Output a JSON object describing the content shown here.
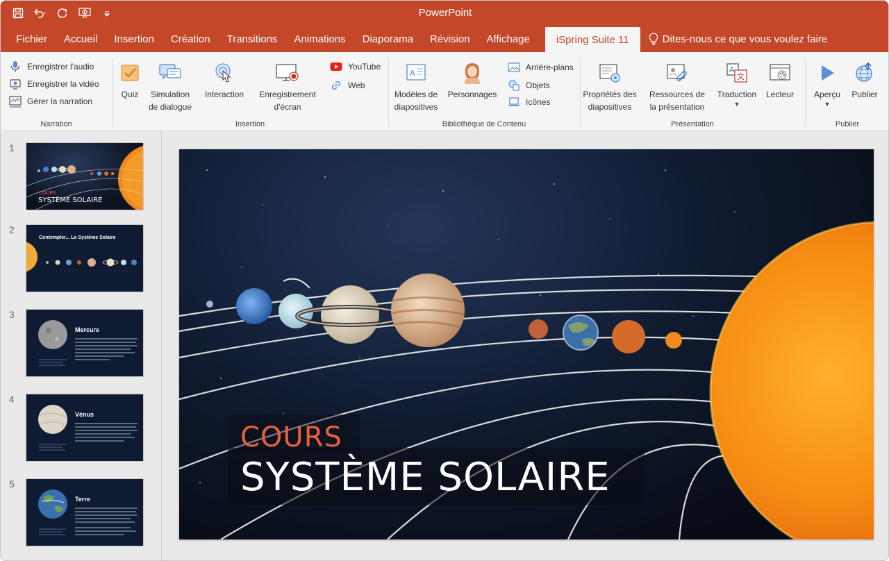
{
  "app": {
    "title": "PowerPoint"
  },
  "qat": {
    "items": [
      "save-icon",
      "undo-icon",
      "redo-icon",
      "present-icon",
      "customize-icon"
    ]
  },
  "tabs": [
    {
      "label": "Fichier"
    },
    {
      "label": "Accueil"
    },
    {
      "label": "Insertion"
    },
    {
      "label": "Création"
    },
    {
      "label": "Transitions"
    },
    {
      "label": "Animations"
    },
    {
      "label": "Diaporama"
    },
    {
      "label": "Révision"
    },
    {
      "label": "Affichage"
    },
    {
      "label": "iSpring Suite 11"
    }
  ],
  "tell_me": {
    "label": "Dites-nous ce que vous voulez faire"
  },
  "ribbon": {
    "narration": {
      "label": "Narration",
      "record_audio": "Enregistrer l'audio",
      "record_video": "Enregistrer la vidéo",
      "manage_narration": "Gérer la narration"
    },
    "insertion": {
      "label": "Insertion",
      "quiz": "Quiz",
      "dialog_sim_line1": "Simulation",
      "dialog_sim_line2": "de dialogue",
      "interaction": "Interaction",
      "screen_rec_line1": "Enregistrement",
      "screen_rec_line2": "d'écran",
      "youtube": "YouTube",
      "web": "Web"
    },
    "content_library": {
      "label": "Bibliothèque de Contenu",
      "templates_line1": "Modèles de",
      "templates_line2": "diapositives",
      "characters": "Personnages",
      "backgrounds": "Arrière-plans",
      "objects": "Objets",
      "icons": "Icônes"
    },
    "presentation": {
      "label": "Présentation",
      "slide_props_line1": "Propriétés des",
      "slide_props_line2": "diapositives",
      "resources_line1": "Ressources de",
      "resources_line2": "la présentation",
      "translation": "Traduction",
      "player": "Lecteur"
    },
    "publish": {
      "label": "Publier",
      "preview": "Aperçu",
      "publish": "Publier"
    }
  },
  "slides": [
    {
      "num": "1",
      "kicker": "COURS",
      "title": "SYSTÈME SOLAIRE"
    },
    {
      "num": "2",
      "title": "Contempler... Le Système Solaire"
    },
    {
      "num": "3",
      "title": "Mercure"
    },
    {
      "num": "4",
      "title": "Vénus"
    },
    {
      "num": "5",
      "title": "Terre"
    }
  ],
  "main_slide": {
    "kicker": "COURS",
    "title": "SYSTÈME SOLAIRE"
  },
  "colors": {
    "titlebar": "#c4472a",
    "ribbon": "#f5f5f5",
    "accent": "#e8603d"
  }
}
